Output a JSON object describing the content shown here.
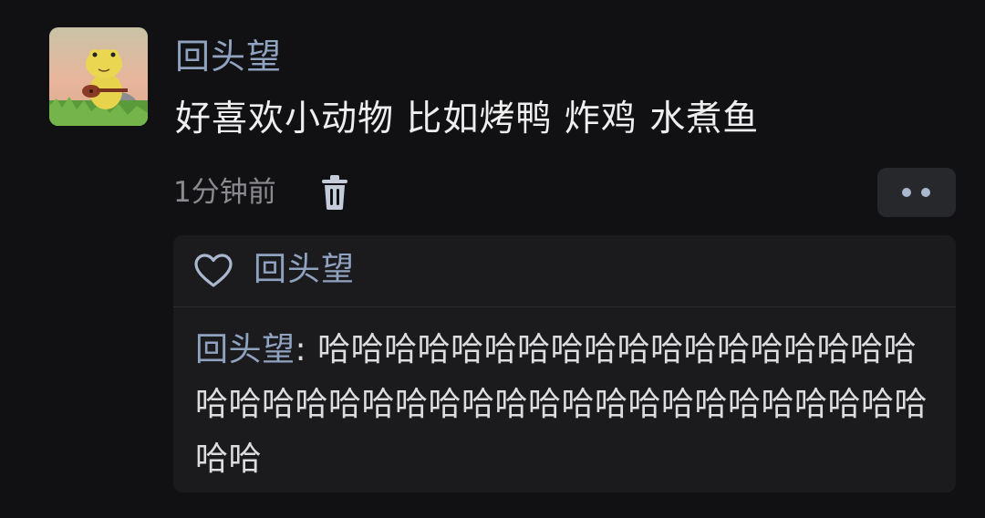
{
  "post": {
    "username": "回头望",
    "comment": "好喜欢小动物 比如烤鸭 炸鸡 水煮鱼",
    "timestamp": "1分钟前",
    "delete_icon": "trash-icon",
    "more_icon": "more-dots-icon"
  },
  "reply_card": {
    "like_icon": "heart-outline-icon",
    "liked_by": "回头望",
    "reply": {
      "author": "回头望",
      "separator": ": ",
      "text": "哈哈哈哈哈哈哈哈哈哈哈哈哈哈哈哈哈哈哈哈哈哈哈哈哈哈哈哈哈哈哈哈哈哈哈哈哈哈哈哈哈哈"
    }
  },
  "colors": {
    "background": "#111113",
    "name_blue": "#8fa2bf",
    "text": "#eeeeee",
    "muted": "#8b8b8f",
    "card": "#1b1b1e"
  }
}
